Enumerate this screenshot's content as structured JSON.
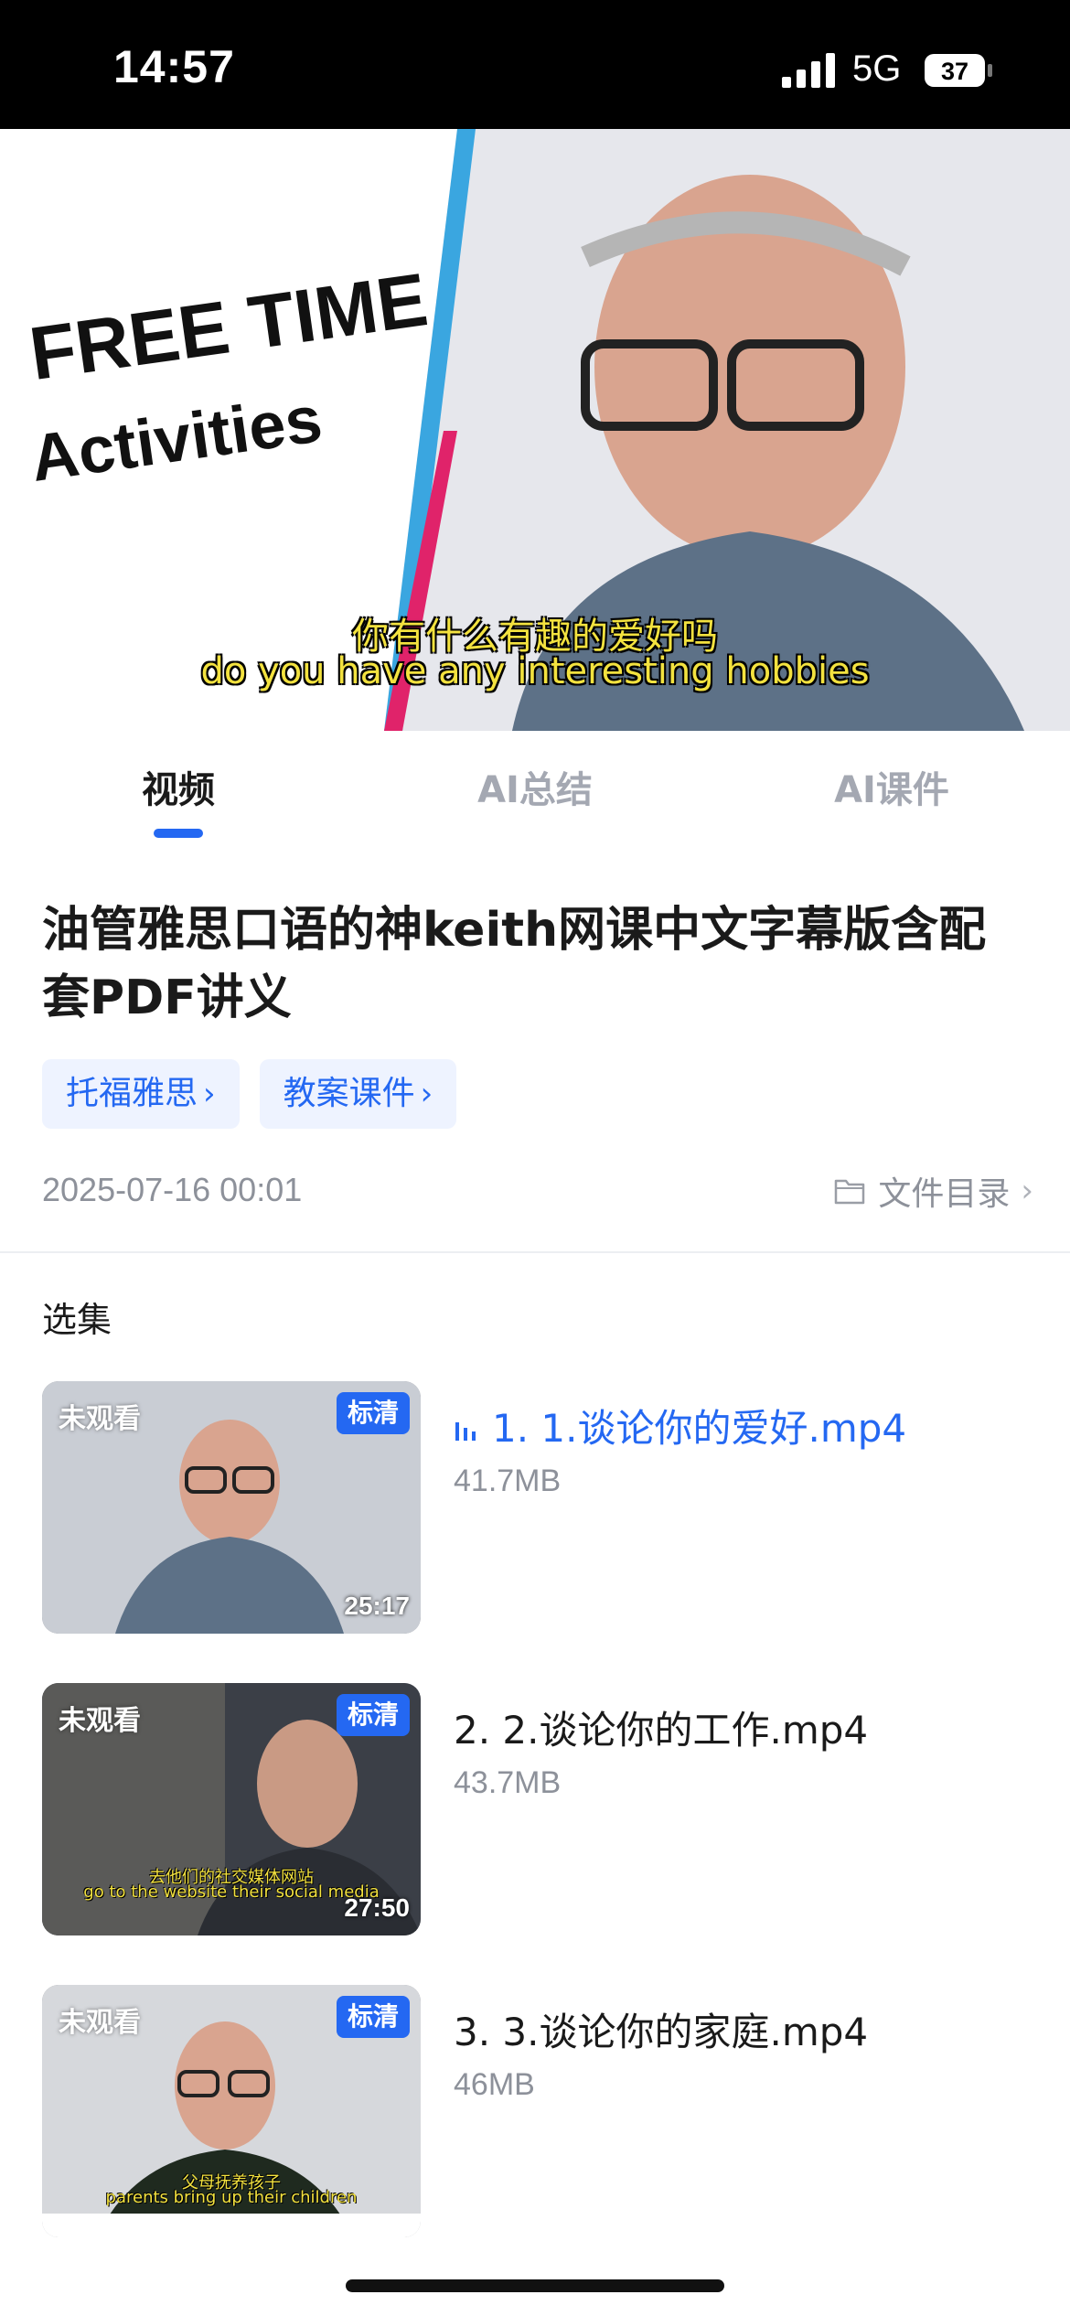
{
  "status_bar": {
    "time": "14:57",
    "network": "5G",
    "battery": "37"
  },
  "player": {
    "title_line1": "FREE TIME",
    "title_line2": "Activities",
    "subtitle_cn": "你有什么有趣的爱好吗",
    "subtitle_en": "do you have any interesting hobbies"
  },
  "tabs": [
    {
      "label": "视频",
      "active": true
    },
    {
      "label": "AI总结",
      "active": false
    },
    {
      "label": "AI课件",
      "active": false
    }
  ],
  "course": {
    "title": "油管雅思口语的神keith网课中文字幕版含配套PDF讲义",
    "tags": [
      "托福雅思",
      "教案课件"
    ],
    "date": "2025-07-16 00:01",
    "catalog_label": "文件目录"
  },
  "episodes_section": {
    "title": "选集",
    "items": [
      {
        "name": "1. 1.谈论你的爱好.mp4",
        "size": "41.7MB",
        "status": "未观看",
        "quality": "标清",
        "duration": "25:17",
        "playing": true,
        "sub_cn": "",
        "sub_en": ""
      },
      {
        "name": "2. 2.谈论你的工作.mp4",
        "size": "43.7MB",
        "status": "未观看",
        "quality": "标清",
        "duration": "27:50",
        "playing": false,
        "sub_cn": "去他们的社交媒体网站",
        "sub_en": "go to the website their social media"
      },
      {
        "name": "3. 3.谈论你的家庭.mp4",
        "size": "46MB",
        "status": "未观看",
        "quality": "标清",
        "duration": "",
        "playing": false,
        "sub_cn": "父母抚养孩子",
        "sub_en": "parents bring up their children"
      }
    ]
  },
  "colors": {
    "accent": "#2468f2",
    "muted": "#8d919a",
    "tag_bg": "#eef3ff"
  }
}
